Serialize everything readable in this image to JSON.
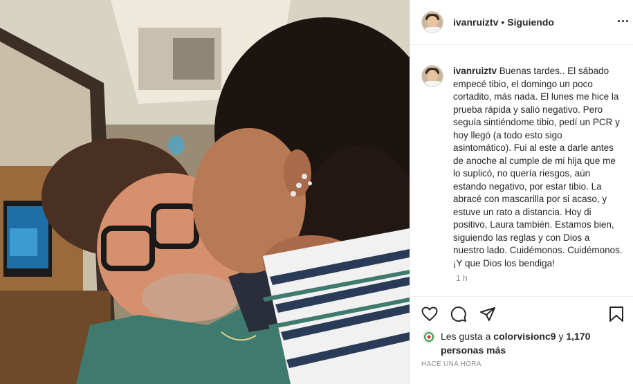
{
  "post": {
    "username": "ivanruiztv",
    "separator": "•",
    "follow_status": "Siguiendo",
    "caption_user": "ivanruiztv",
    "caption_text": "Buenas tardes.. El sábado empecé tibio, el domingo un poco cortadito, más nada. El lunes me hice la prueba rápida y salió negativo. Pero seguía sintiéndome tibio, pedí un PCR y hoy llegó (a todo esto sigo asintomático). Fui al este a darle antes de anoche al cumple de mi hija que me lo suplicó, no quería riesgos, aún estando negativo, por estar tibio. La abracé con mascarilla por si acaso, y estuve un rato a distancia. Hoy di positivo, Laura también. Estamos bien, siguiendo las reglas y con Dios a nuestro lado. Cuidémonos. Cuidémonos. ¡Y que Dios los bendiga!",
    "caption_time": "1 h",
    "likes_prefix": "Les gusta a",
    "likes_user": "colorvisionc9",
    "likes_conjunction": "y",
    "likes_others": "1,170 personas más",
    "posted_ago": "HACE UNA HORA"
  },
  "icons": {
    "more": "more-options-icon",
    "like": "heart-icon",
    "comment": "comment-icon",
    "share": "share-icon",
    "save": "bookmark-icon",
    "liker_logo": "colorvision-logo-icon"
  },
  "colors": {
    "text": "#262626",
    "muted": "#8e8e8e",
    "border": "#efefef"
  }
}
